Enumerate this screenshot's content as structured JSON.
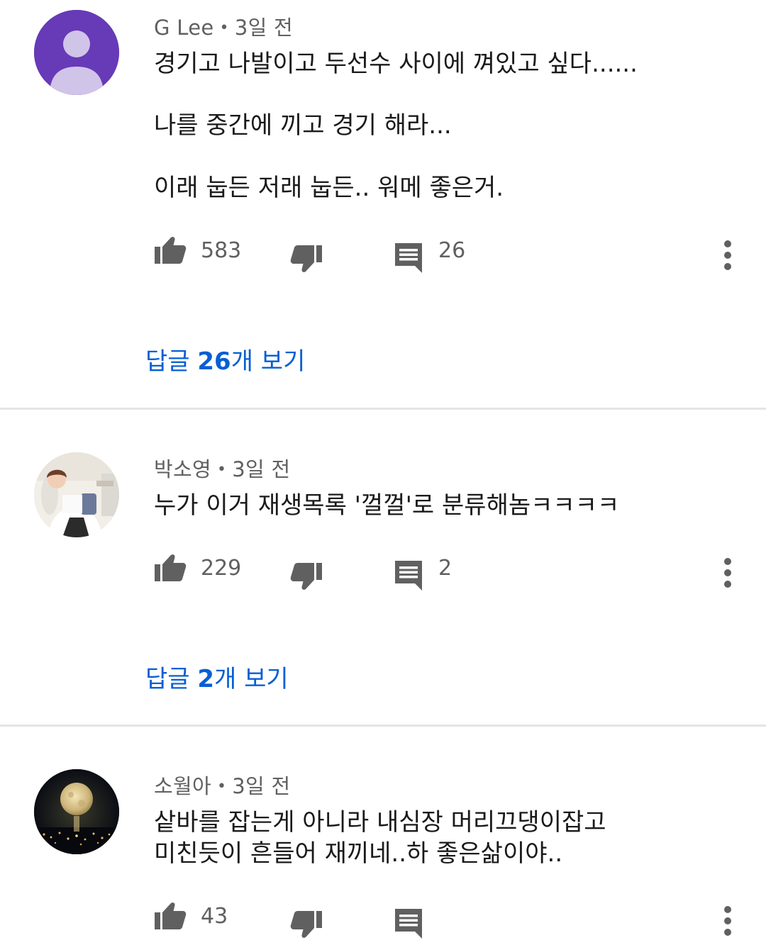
{
  "comments": [
    {
      "author": "G Lee",
      "separator": "•",
      "time": "3일 전",
      "lines": [
        "경기고 나발이고 두선수 사이에 껴있고 싶다......",
        "나를 중간에 끼고 경기 해라...",
        "이래 눕든 저래 눕든.. 워메 좋은거."
      ],
      "likes": "583",
      "reply_count": "26",
      "replies_prefix": "답글 ",
      "replies_num": "26",
      "replies_suffix": "개 보기",
      "avatar_type": "default-person-icon",
      "avatar_color": "#673ab7"
    },
    {
      "author": "박소영",
      "separator": "•",
      "time": "3일 전",
      "lines": [
        "누가 이거 재생목록 '껄껄'로 분류해놈ㅋㅋㅋㅋ"
      ],
      "likes": "229",
      "reply_count": "2",
      "replies_prefix": "답글 ",
      "replies_num": "2",
      "replies_suffix": "개 보기",
      "avatar_type": "photo-person"
    },
    {
      "author": "소월아",
      "separator": "•",
      "time": "3일 전",
      "lines": [
        "샅바를 잡는게 아니라 내심장 머리끄댕이잡고",
        "미친듯이 흔들어 재끼네..하 좋은삶이야.."
      ],
      "likes": "43",
      "reply_count": "",
      "avatar_type": "photo-moon"
    }
  ],
  "colors": {
    "link": "#065fd4",
    "meta": "#606060",
    "icon": "#606060",
    "divider": "#e5e5e5"
  },
  "icons": {
    "like": "thumbs-up-icon",
    "dislike": "thumbs-down-icon",
    "reply": "comment-icon",
    "more": "more-vert-icon"
  }
}
